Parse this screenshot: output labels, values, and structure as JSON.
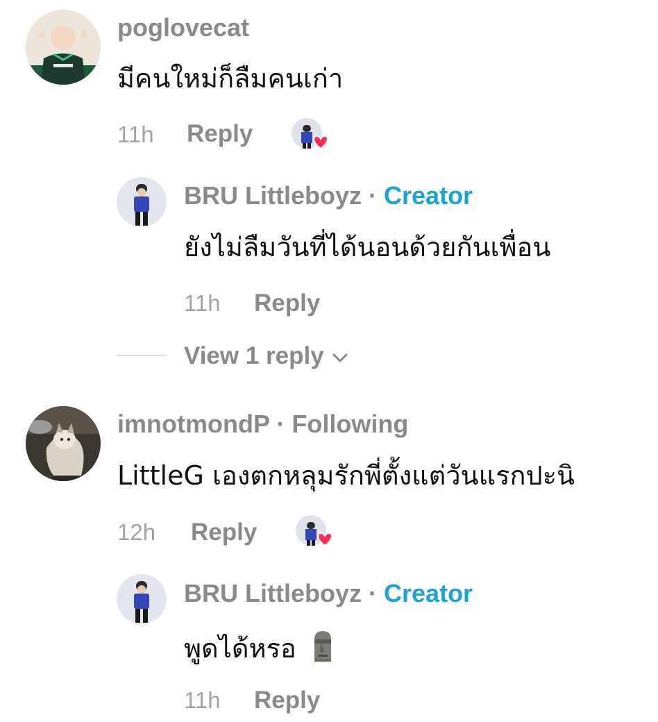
{
  "comments": [
    {
      "username": "poglovecat",
      "text": "มีคนใหม่ก็ลืมคนเก่า",
      "time": "11h",
      "reply_label": "Reply",
      "reply": {
        "username": "BRU Littleboyz",
        "separator": "·",
        "badge": "Creator",
        "text": "ยังไม่ลืมวันที่ได้นอนด้วยกันเพื่อน",
        "time": "11h",
        "reply_label": "Reply"
      },
      "view_replies": "View 1 reply"
    },
    {
      "username": "imnotmondP",
      "separator": "·",
      "badge": "Following",
      "text": "LittleG เองตกหลุมรักพี่ตั้งแต่วันแรกปะนิ",
      "time": "12h",
      "reply_label": "Reply",
      "reply": {
        "username": "BRU Littleboyz",
        "separator": "·",
        "badge": "Creator",
        "text": "พูดได้หรอ",
        "time": "11h",
        "reply_label": "Reply"
      }
    }
  ],
  "colors": {
    "creator_accent": "#1ba3d1",
    "heart": "#fe2c55",
    "muted_text": "#8a8a8a"
  },
  "icons": [
    "avatar",
    "creator-liked-heart-icon",
    "chevron-down-icon",
    "moai-emoji"
  ]
}
